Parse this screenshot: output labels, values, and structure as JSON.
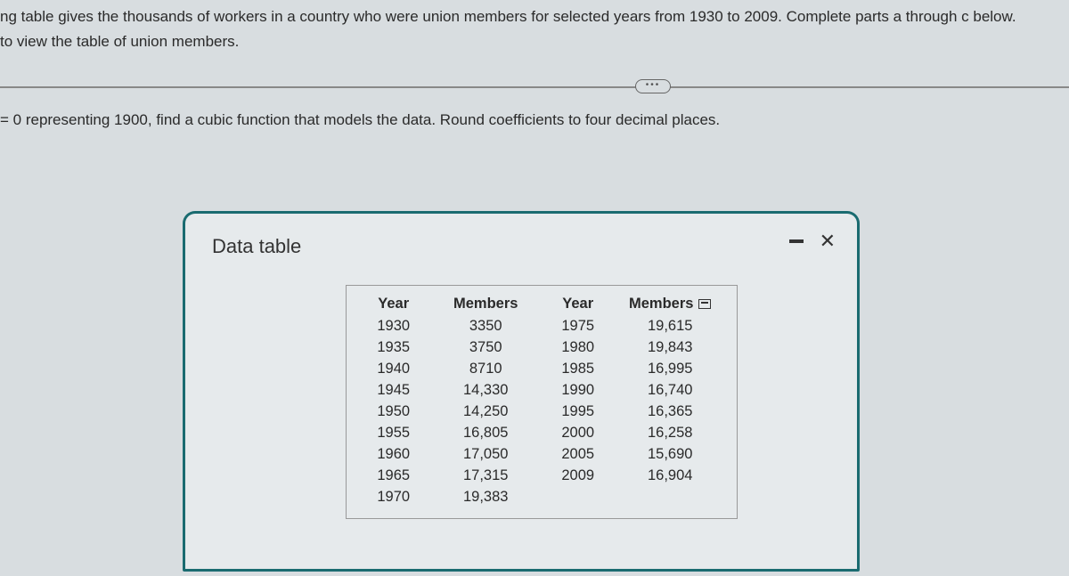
{
  "intro": {
    "line1": "ng table gives the thousands of workers in a country who were union members for selected years from 1930 to 2009. Complete parts a through c below.",
    "line2": "to view the table of union members."
  },
  "ellipsis": "•••",
  "question": "= 0 representing 1900, find a cubic function that models the data. Round coefficients to four decimal places.",
  "modal": {
    "title": "Data table",
    "headers": {
      "year": "Year",
      "members": "Members"
    },
    "left": [
      {
        "year": "1930",
        "members": "3350"
      },
      {
        "year": "1935",
        "members": "3750"
      },
      {
        "year": "1940",
        "members": "8710"
      },
      {
        "year": "1945",
        "members": "14,330"
      },
      {
        "year": "1950",
        "members": "14,250"
      },
      {
        "year": "1955",
        "members": "16,805"
      },
      {
        "year": "1960",
        "members": "17,050"
      },
      {
        "year": "1965",
        "members": "17,315"
      },
      {
        "year": "1970",
        "members": "19,383"
      }
    ],
    "right": [
      {
        "year": "1975",
        "members": "19,615"
      },
      {
        "year": "1980",
        "members": "19,843"
      },
      {
        "year": "1985",
        "members": "16,995"
      },
      {
        "year": "1990",
        "members": "16,740"
      },
      {
        "year": "1995",
        "members": "16,365"
      },
      {
        "year": "2000",
        "members": "16,258"
      },
      {
        "year": "2005",
        "members": "15,690"
      },
      {
        "year": "2009",
        "members": "16,904"
      },
      {
        "year": "",
        "members": ""
      }
    ]
  }
}
